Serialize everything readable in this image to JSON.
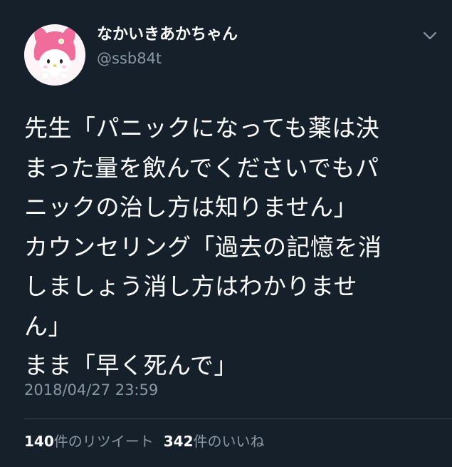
{
  "user": {
    "display_name": "なかいきあかちゃん",
    "handle": "@ssb84t",
    "avatar_icon": "pink-hood-character-avatar-icon"
  },
  "tweet": {
    "lines": [
      "先生「パニックになっても薬は決",
      "まった量を飲んでくださいでもパ",
      "ニックの治し方は知りません」",
      "カウンセリング「過去の記憶を消",
      "しましょう消し方はわかりませ",
      "ん」",
      "まま「早く死んで」"
    ],
    "timestamp": "2018/04/27 23:59"
  },
  "stats": {
    "retweets_count": "140",
    "retweets_label": "件のリツイート",
    "likes_count": "342",
    "likes_label": "件のいいね"
  },
  "icons": {
    "menu": "chevron-down-icon"
  },
  "colors": {
    "background": "#15202b",
    "text_primary": "#ffffff",
    "text_secondary": "#8899a6",
    "divider": "#38444d",
    "avatar_pink": "#f06c9b"
  }
}
